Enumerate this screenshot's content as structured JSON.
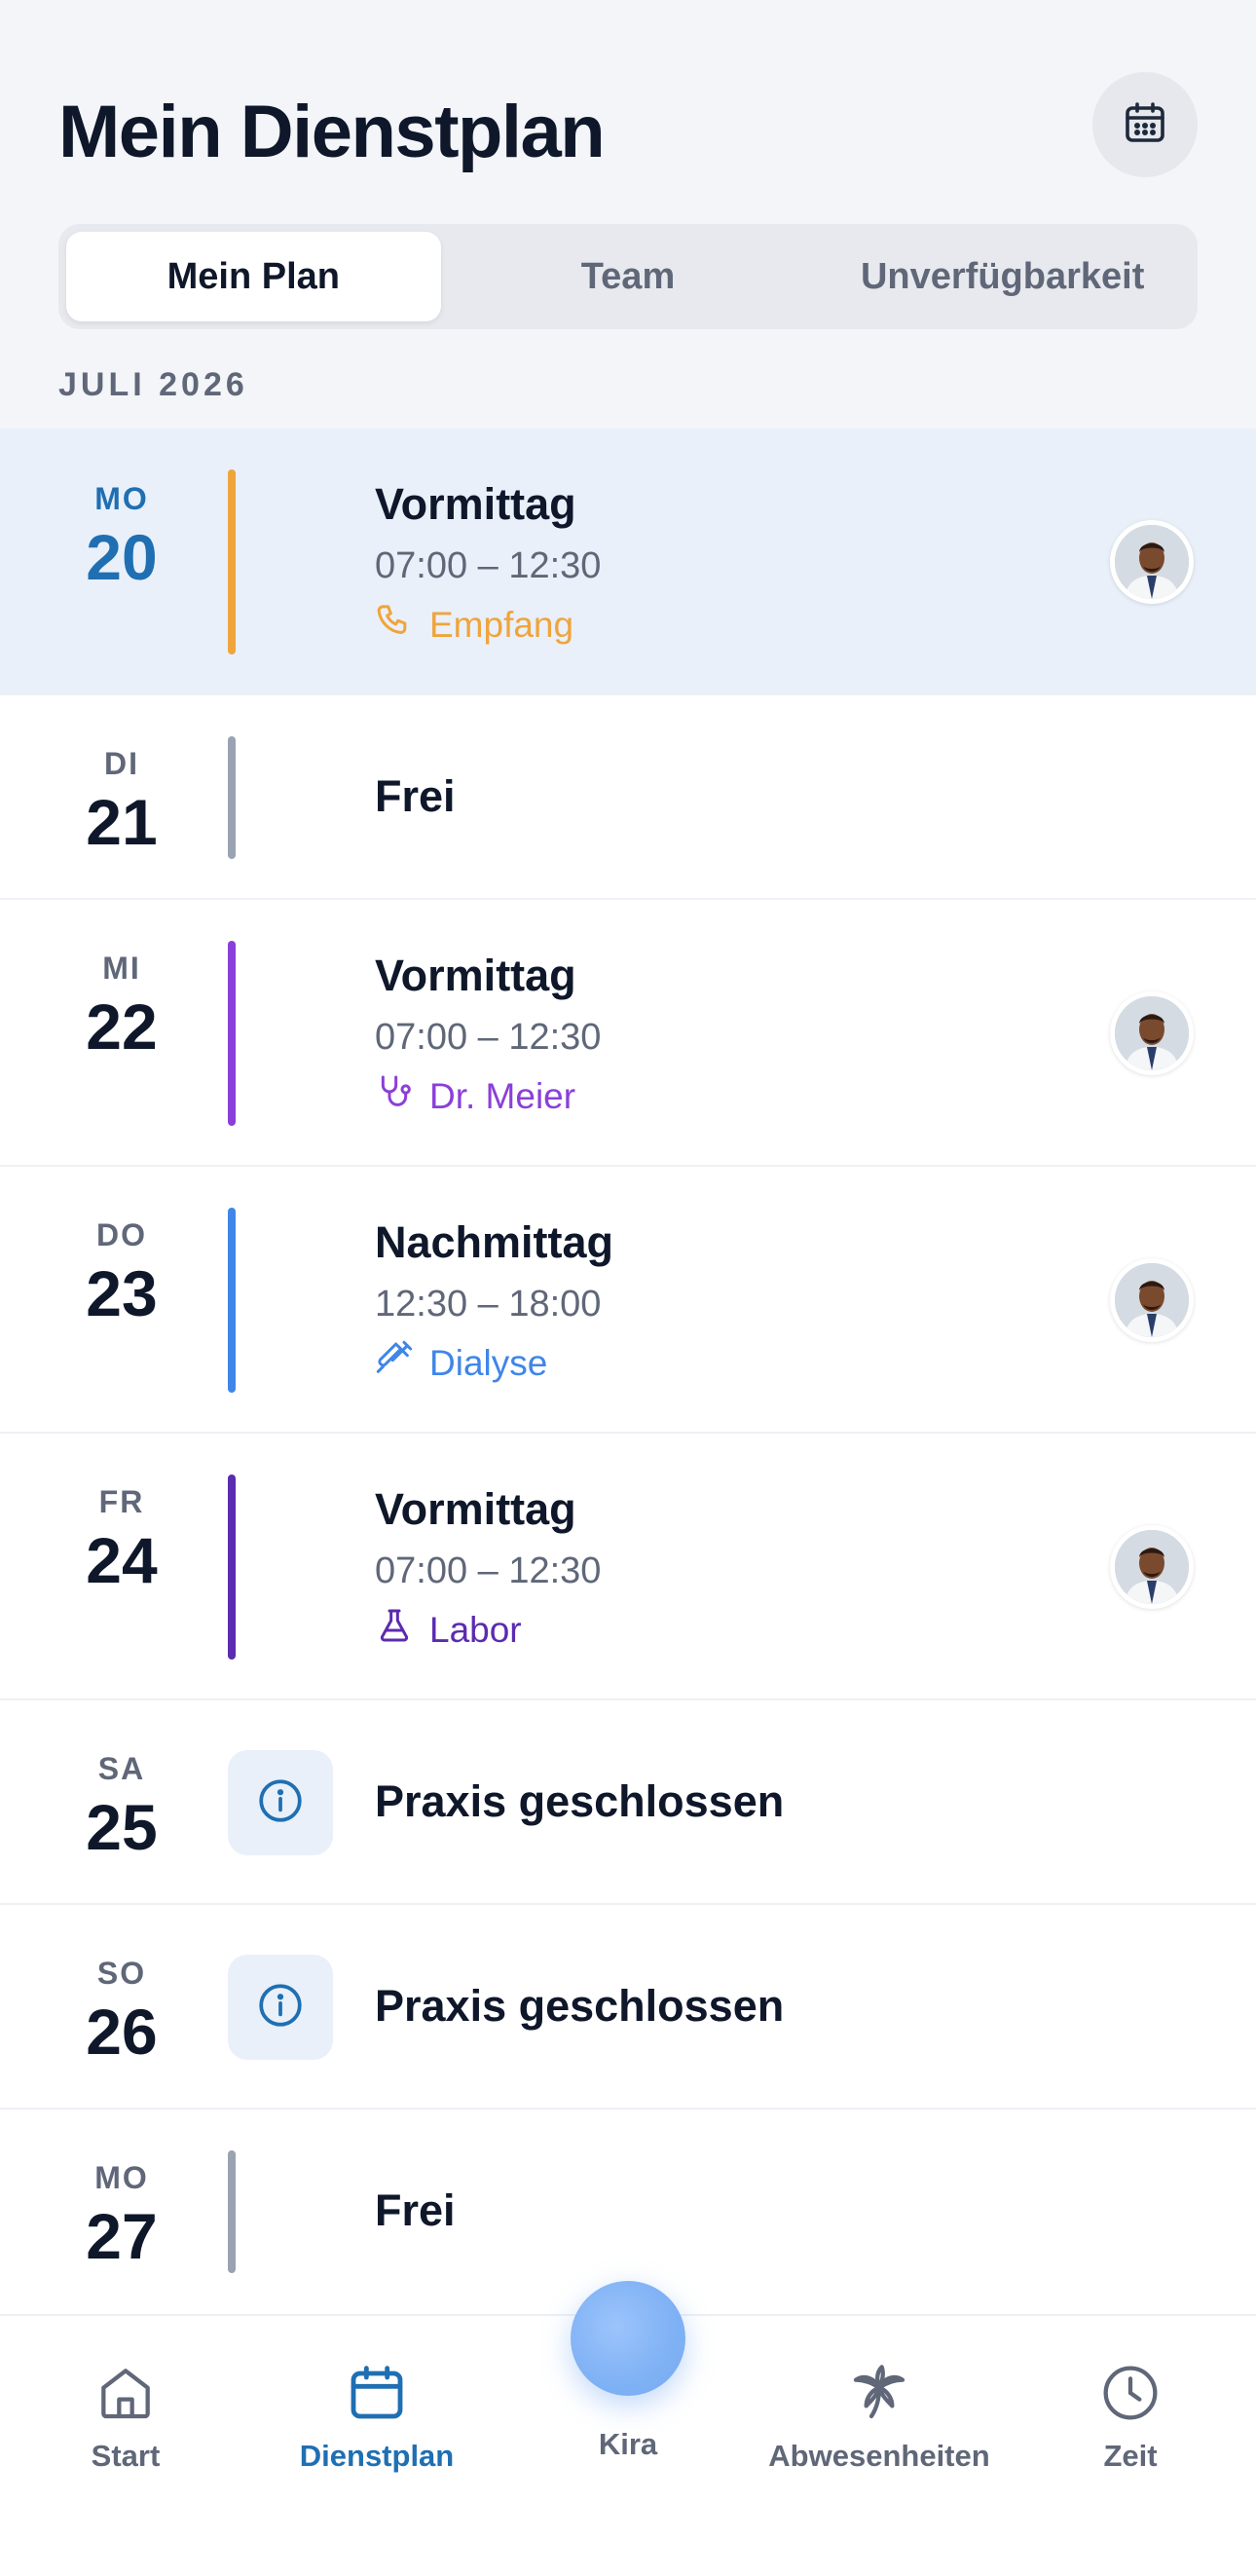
{
  "header": {
    "title": "Mein Dienstplan",
    "calendar_icon": "calendar-icon"
  },
  "tabs": [
    {
      "label": "Mein Plan",
      "active": true
    },
    {
      "label": "Team",
      "active": false
    },
    {
      "label": "Unverfügbarkeit",
      "active": false
    }
  ],
  "month_label": "JULI 2026",
  "days": [
    {
      "dow": "MO",
      "day": "20",
      "type": "shift",
      "highlight": true,
      "title": "Vormittag",
      "time": "07:00 – 12:30",
      "location": "Empfang",
      "loc_icon": "phone-icon",
      "color": "#f0a43c"
    },
    {
      "dow": "DI",
      "day": "21",
      "type": "free",
      "title": "Frei",
      "color": "#9aa3b2"
    },
    {
      "dow": "MI",
      "day": "22",
      "type": "shift",
      "title": "Vormittag",
      "time": "07:00 – 12:30",
      "location": "Dr. Meier",
      "loc_icon": "stethoscope-icon",
      "color": "#8b3fd9"
    },
    {
      "dow": "DO",
      "day": "23",
      "type": "shift",
      "title": "Nachmittag",
      "time": "12:30 – 18:00",
      "location": "Dialyse",
      "loc_icon": "syringe-icon",
      "color": "#3f86e8"
    },
    {
      "dow": "FR",
      "day": "24",
      "type": "shift",
      "title": "Vormittag",
      "time": "07:00 – 12:30",
      "location": "Labor",
      "loc_icon": "flask-icon",
      "color": "#5b2bb0"
    },
    {
      "dow": "SA",
      "day": "25",
      "type": "closed",
      "title": "Praxis geschlossen",
      "color": "#1f6fb2"
    },
    {
      "dow": "SO",
      "day": "26",
      "type": "closed",
      "title": "Praxis geschlossen",
      "color": "#1f6fb2"
    },
    {
      "dow": "MO",
      "day": "27",
      "type": "free",
      "title": "Frei",
      "color": "#9aa3b2"
    }
  ],
  "nav": [
    {
      "label": "Start",
      "icon": "home-icon",
      "active": false
    },
    {
      "label": "Dienstplan",
      "icon": "calendar-icon",
      "active": true
    },
    {
      "label": "Kira",
      "icon": "kira-orb",
      "active": false
    },
    {
      "label": "Abwesenheiten",
      "icon": "palm-tree-icon",
      "active": false
    },
    {
      "label": "Zeit",
      "icon": "clock-icon",
      "active": false
    }
  ],
  "colors": {
    "accent": "#1f6fb2",
    "highlight_bg": "#e9f0fa",
    "text": "#0f172a",
    "muted": "#5f6778"
  }
}
